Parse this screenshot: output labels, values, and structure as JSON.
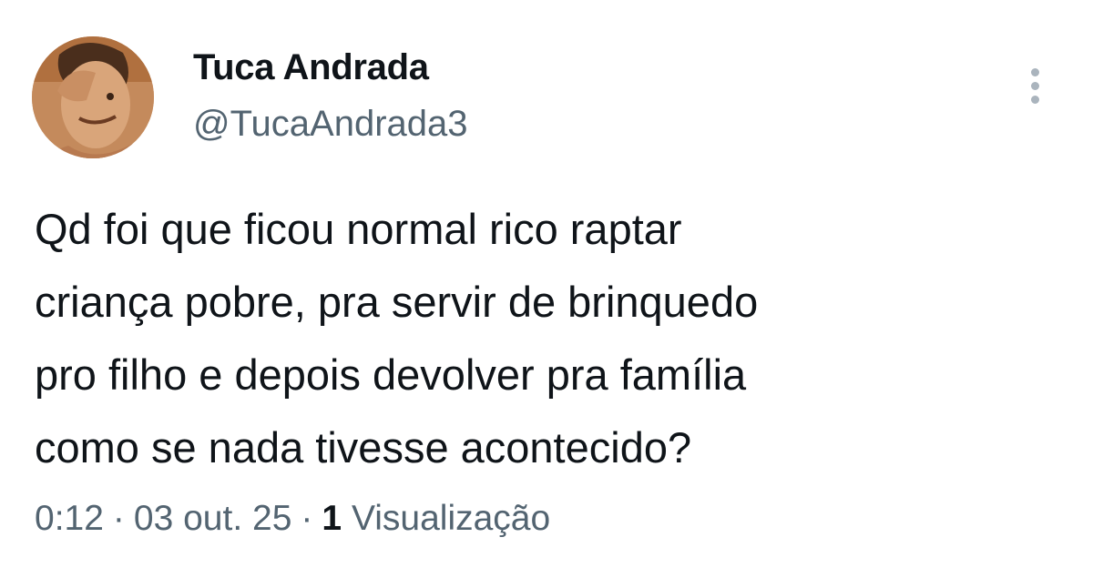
{
  "user": {
    "display_name": "Tuca Andrada",
    "handle": "@TucaAndrada3"
  },
  "tweet": {
    "lines": [
      "Qd foi que ficou normal rico raptar",
      "criança pobre, pra servir de brinquedo",
      "pro filho e depois devolver pra família",
      "como se nada tivesse acontecido?"
    ]
  },
  "meta": {
    "time": "0:12",
    "date": "03 out. 25",
    "separator": "·",
    "views_count": "1",
    "views_label": "Visualização"
  },
  "icons": {
    "more": "more-vertical-icon"
  },
  "colors": {
    "text": "#0f1419",
    "secondary": "#536471"
  }
}
